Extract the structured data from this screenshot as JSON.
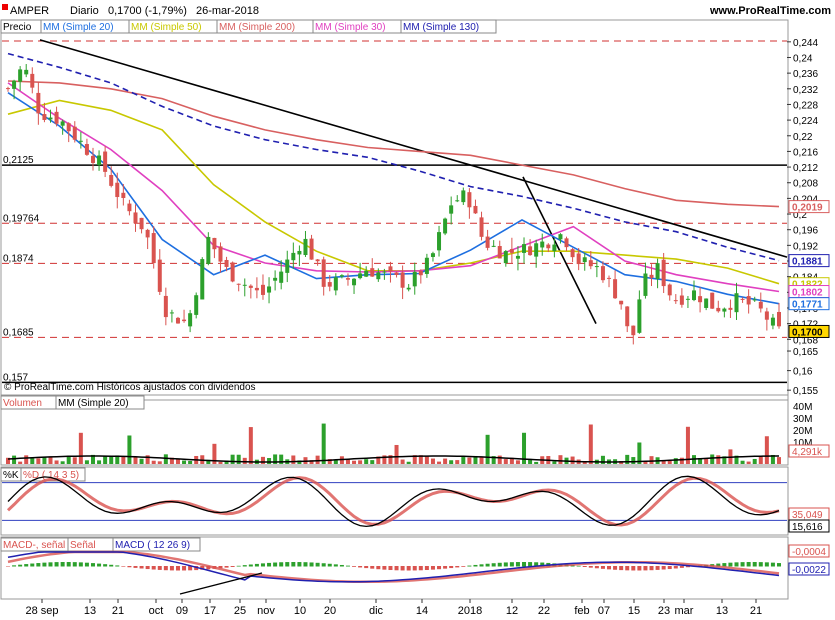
{
  "header": {
    "symbol": "AMPER",
    "timeframe": "Diario",
    "last": "0,1700 (-1,79%)",
    "date": "26-mar-2018",
    "site": "www.ProRealTime.com"
  },
  "legend_price": {
    "price": "Precio",
    "ma20": "MM (Simple 20)",
    "ma50": "MM (Simple 50)",
    "ma200": "MM (Simple 200)",
    "ma30": "MM (Simple 30)",
    "ma130": "MM (Simple 130)"
  },
  "footnote": "© ProRealTime.com  Históricos ajustados con dividendos",
  "legend_volume": {
    "volume": "Volumen",
    "ma": "MM (Simple 20)"
  },
  "legend_stoch": {
    "k": "%K",
    "d": "%D ( 14 3 5)"
  },
  "legend_macd": {
    "macd_minus": "MACD-, señal",
    "signal": "Señal",
    "macd": "MACD ( 12 26 9)"
  },
  "colors": {
    "ma20": "#1e6fe0",
    "ma50": "#c8c800",
    "ma200": "#d86060",
    "ma30": "#e040c0",
    "ma130": "#2020b0",
    "up": "#2ca02c",
    "down": "#d9534f",
    "label_last_bg": "#ffd700"
  },
  "chart_data": [
    {
      "type": "candlestick",
      "title": "AMPER Diario",
      "ylim": [
        0.153,
        0.246
      ],
      "y_ticks": [
        "0,244",
        "0,24",
        "0,236",
        "0,232",
        "0,228",
        "0,224",
        "0,22",
        "0,216",
        "0,212",
        "0,208",
        "0,204",
        "0,2",
        "0,196",
        "0,192",
        "0,188",
        "0,184",
        "0,18",
        "0,176",
        "0,172",
        "0,168",
        "0,165",
        "0,16",
        "0,155"
      ],
      "x_ticks": [
        "28 sep",
        "13",
        "21",
        "oct",
        "09",
        "17",
        "25",
        "nov",
        "10",
        "20",
        "dic",
        "14",
        "2018",
        "12",
        "22",
        "feb",
        "07",
        "15",
        "23",
        "mar",
        "13",
        "21"
      ],
      "levels": {
        "solid": [
          {
            "label": "0,2125",
            "value": 0.2125
          },
          {
            "label": "0,157",
            "value": 0.157
          }
        ],
        "dashed": [
          {
            "label": "",
            "value": 0.2442
          },
          {
            "label": "0,19764",
            "value": 0.19764
          },
          {
            "label": "0,1874",
            "value": 0.1874
          },
          {
            "label": "0,1685",
            "value": 0.1685
          }
        ]
      },
      "ma_labels": [
        {
          "name": "MM (Simple 200)",
          "value": "0,2019"
        },
        {
          "name": "MM (Simple 20)",
          "value": "0,1881"
        },
        {
          "name": "MM (Simple 50)",
          "value": "0,1822"
        },
        {
          "name": "MM (Simple 30)",
          "value": "0,1802"
        },
        {
          "name": "MM (Simple 20)",
          "value": "0,1771"
        },
        {
          "name": "Precio",
          "value": "0,1700"
        }
      ],
      "series": [
        {
          "name": "MM (Simple 200)",
          "values": [
            0.234,
            0.2335,
            0.232,
            0.2295,
            0.225,
            0.2215,
            0.219,
            0.217,
            0.216,
            0.215,
            0.2125,
            0.21,
            0.2065,
            0.2035,
            0.2025,
            0.2019
          ]
        },
        {
          "name": "MM (Simple 130)",
          "values": [
            0.241,
            0.2375,
            0.2335,
            0.2275,
            0.2225,
            0.219,
            0.2165,
            0.2145,
            0.211,
            0.207,
            0.2045,
            0.2015,
            0.198,
            0.1955,
            0.1915,
            0.1881
          ]
        },
        {
          "name": "MM (Simple 50)",
          "values": [
            0.2255,
            0.229,
            0.2265,
            0.2215,
            0.2075,
            0.198,
            0.1905,
            0.1855,
            0.1855,
            0.1875,
            0.1905,
            0.1905,
            0.1895,
            0.1885,
            0.1862,
            0.1822
          ]
        },
        {
          "name": "MM (Simple 30)",
          "values": [
            0.2335,
            0.2245,
            0.2165,
            0.206,
            0.192,
            0.1875,
            0.1855,
            0.1852,
            0.1855,
            0.1868,
            0.1918,
            0.1968,
            0.188,
            0.1845,
            0.1822,
            0.1802
          ]
        },
        {
          "name": "MM (Simple 20)",
          "values": [
            0.231,
            0.2225,
            0.2115,
            0.1935,
            0.1845,
            0.1895,
            0.1835,
            0.1845,
            0.1848,
            0.1908,
            0.1985,
            0.1915,
            0.1845,
            0.1828,
            0.1795,
            0.1771
          ]
        }
      ]
    },
    {
      "type": "bar",
      "title": "Volumen",
      "y_ticks": [
        "40M",
        "30M",
        "20M",
        "10M",
        "4,291k"
      ],
      "last": "4,291k"
    },
    {
      "type": "line",
      "title": "%K %D ( 14 3 5)",
      "y_ticks": [
        "35,049",
        "15,616"
      ],
      "levels": [
        80,
        20
      ]
    },
    {
      "type": "area",
      "title": "MACD ( 12 26 9)",
      "y_ticks": [
        "-0,0004",
        "-0,0022"
      ]
    }
  ]
}
